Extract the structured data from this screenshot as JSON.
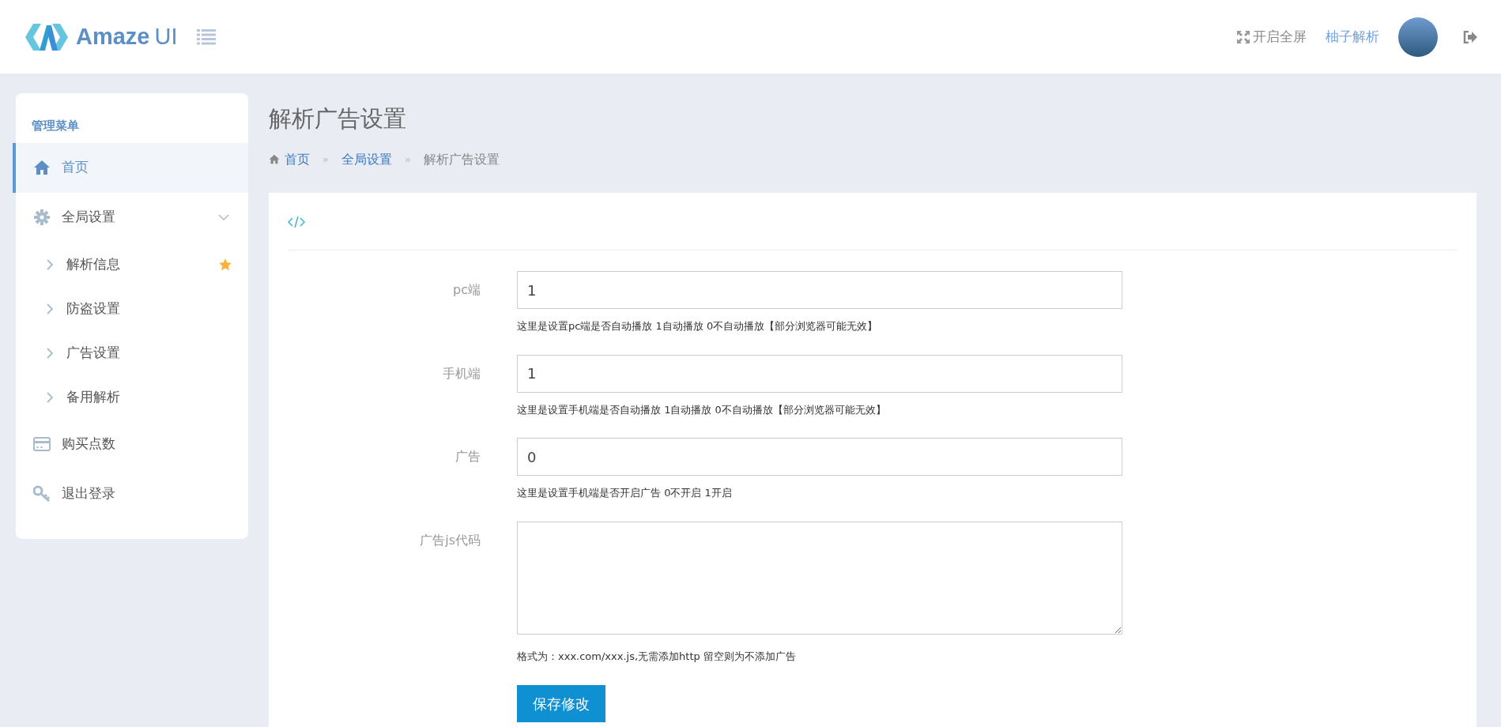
{
  "header": {
    "logo_text": "Amaze",
    "logo_suffix": "UI",
    "fullscreen_label": "开启全屏",
    "user_name": "柚子解析"
  },
  "sidebar": {
    "title": "管理菜单",
    "items": [
      {
        "label": "首页",
        "selected": true
      },
      {
        "label": "全局设置",
        "selected": false,
        "expanded": true,
        "children": [
          {
            "label": "解析信息",
            "starred": true
          },
          {
            "label": "防盗设置",
            "starred": false
          },
          {
            "label": "广告设置",
            "starred": false
          },
          {
            "label": "备用解析",
            "starred": false
          }
        ]
      },
      {
        "label": "购买点数",
        "selected": false
      },
      {
        "label": "退出登录",
        "selected": false
      }
    ]
  },
  "page_title": "解析广告设置",
  "breadcrumb": [
    {
      "label": "首页",
      "link": true
    },
    {
      "separator": "»",
      "label": "全局设置",
      "link": true
    },
    {
      "separator": "»",
      "label": "解析广告设置",
      "link": false
    }
  ],
  "form": {
    "fields": [
      {
        "kind": "input",
        "label": "pc端",
        "value": "1",
        "help": "这里是设置pc端是否自动播放 1自动播放 0不自动播放【部分浏览器可能无效】"
      },
      {
        "kind": "input",
        "label": "手机端",
        "value": "1",
        "help": "这里是设置手机端是否自动播放 1自动播放 0不自动播放【部分浏览器可能无效】"
      },
      {
        "kind": "input",
        "label": "广告",
        "value": "0",
        "help": "这里是设置手机端是否开启广告 0不开启 1开启"
      },
      {
        "kind": "textarea",
        "label": "广告js代码",
        "help": "格式为：xxx.com/xxx.js,无需添加http 留空则为不添加广告"
      }
    ],
    "submit": "保存修改"
  }
}
